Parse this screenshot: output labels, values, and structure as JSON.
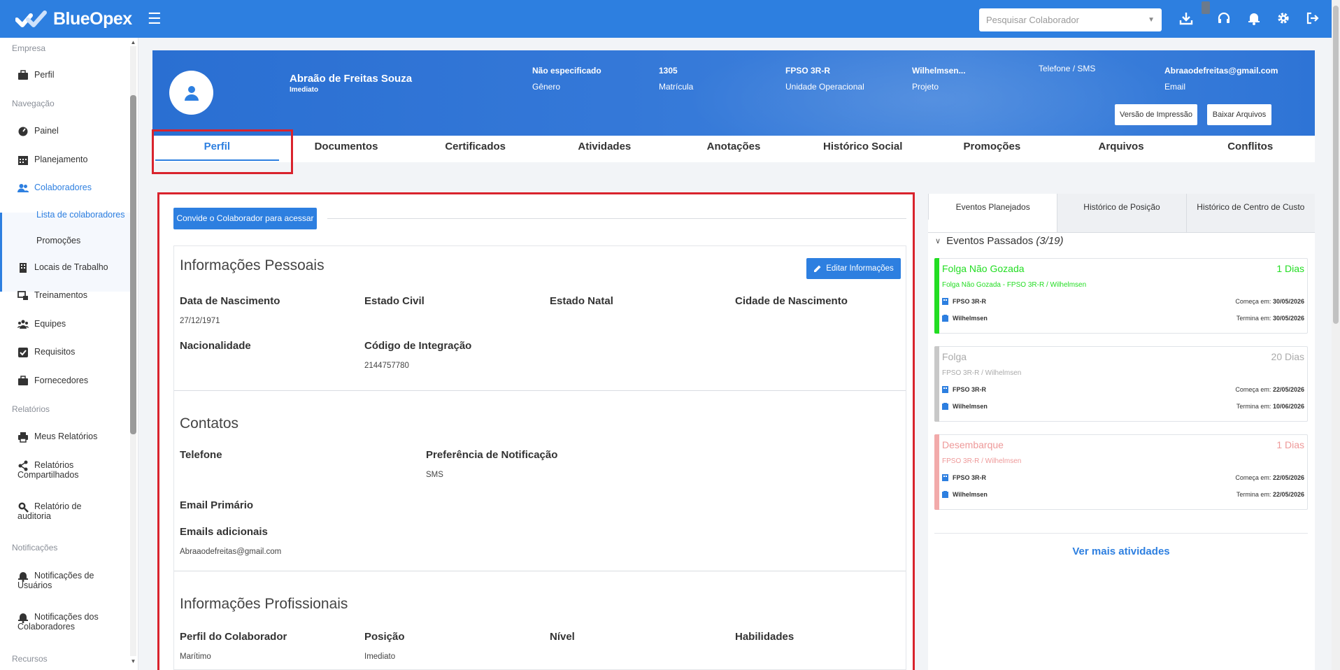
{
  "topbar": {
    "brand": "BlueOpex",
    "search_placeholder": "Pesquisar Colaborador",
    "icons": [
      "download-icon",
      "headset-icon",
      "bell-icon",
      "gear-icon",
      "logout-icon"
    ]
  },
  "sidebar": {
    "sections": {
      "empresa": "Empresa",
      "navegacao": "Navegação",
      "relatorios": "Relatórios",
      "notificacoes": "Notificações",
      "recursos": "Recursos"
    },
    "items": {
      "perfil": "Perfil",
      "painel": "Painel",
      "planejamento": "Planejamento",
      "colaboradores": "Colaboradores",
      "lista": "Lista de colaboradores",
      "promocoes": "Promoções",
      "locais": "Locais de Trabalho",
      "treinamentos": "Treinamentos",
      "equipes": "Equipes",
      "requisitos": "Requisitos",
      "fornecedores": "Fornecedores",
      "meus_relatorios": "Meus Relatórios",
      "relatorios_compartilhados_1": "Relatórios",
      "relatorios_compartilhados_2": "Compartilhados",
      "relatorio_auditoria_1": "Relatório de",
      "relatorio_auditoria_2": "auditoria",
      "notif_usuarios_1": "Notificações de",
      "notif_usuarios_2": "Usuários",
      "notif_colab_1": "Notificações dos",
      "notif_colab_2": "Colaboradores"
    }
  },
  "profile": {
    "name": "Abraão de Freitas Souza",
    "role": "Imediato",
    "fields": [
      {
        "value": "Não especificado",
        "label": "Gênero"
      },
      {
        "value": "1305",
        "label": "Matrícula"
      },
      {
        "value": "FPSO 3R-R",
        "label": "Unidade Operacional"
      },
      {
        "value": "Wilhelmsen...",
        "label": "Projeto"
      },
      {
        "value": "",
        "label": "Telefone / SMS"
      },
      {
        "value": "Abraaodefreitas@gmail.com",
        "label": "Email"
      }
    ],
    "print_button": "Versão de Impressão",
    "download_button": "Baixar Arquivos"
  },
  "tabs": [
    "Perfil",
    "Documentos",
    "Certificados",
    "Atividades",
    "Anotações",
    "Histórico Social",
    "Promoções",
    "Arquivos",
    "Conflitos"
  ],
  "main": {
    "invite_button": "Convide o Colaborador para acessar",
    "edit_button": "Editar Informações",
    "personal": {
      "title": "Informações Pessoais",
      "birth_label": "Data de Nascimento",
      "birth_value": "27/12/1971",
      "civil_label": "Estado Civil",
      "state_label": "Estado Natal",
      "city_label": "Cidade de Nascimento",
      "nationality_label": "Nacionalidade",
      "integration_label": "Código de Integração",
      "integration_value": "2144757780"
    },
    "contacts": {
      "title": "Contatos",
      "phone_label": "Telefone",
      "notif_pref_label": "Preferência de Notificação",
      "notif_pref_value": "SMS",
      "primary_email_label": "Email Primário",
      "additional_emails_label": "Emails adicionais",
      "additional_emails_value": "Abraaodefreitas@gmail.com"
    },
    "professional": {
      "title": "Informações Profissionais",
      "profile_label": "Perfil do Colaborador",
      "profile_value": "Marítimo",
      "position_label": "Posição",
      "position_value": "Imediato",
      "level_label": "Nível",
      "skills_label": "Habilidades"
    }
  },
  "right": {
    "tabs": [
      "Eventos Planejados",
      "Histórico de Posição",
      "Histórico de Centro de Custo"
    ],
    "past_label": "Eventos Passados",
    "past_count": "(3/19)",
    "events": [
      {
        "title": "Folga Não Gozada",
        "days": "1 Dias",
        "subtitle": "Folga Não Gozada - FPSO 3R-R / Wilhelmsen",
        "unit": "FPSO 3R-R",
        "project": "Wilhelmsen",
        "start_label": "Começa em:",
        "start": "30/05/2026",
        "end_label": "Termina em:",
        "end": "30/05/2026",
        "color": "#22dd22"
      },
      {
        "title": "Folga",
        "days": "20 Dias",
        "subtitle": "FPSO 3R-R / Wilhelmsen",
        "unit": "FPSO 3R-R",
        "project": "Wilhelmsen",
        "start_label": "Começa em:",
        "start": "22/05/2026",
        "end_label": "Termina em:",
        "end": "10/06/2026",
        "color": "#c8c8c8"
      },
      {
        "title": "Desembarque",
        "days": "1 Dias",
        "subtitle": "FPSO 3R-R / Wilhelmsen",
        "unit": "FPSO 3R-R",
        "project": "Wilhelmsen",
        "start_label": "Começa em:",
        "start": "22/05/2026",
        "end_label": "Termina em:",
        "end": "22/05/2026",
        "color": "#f2aaaa"
      }
    ],
    "more_link": "Ver mais atividades"
  }
}
